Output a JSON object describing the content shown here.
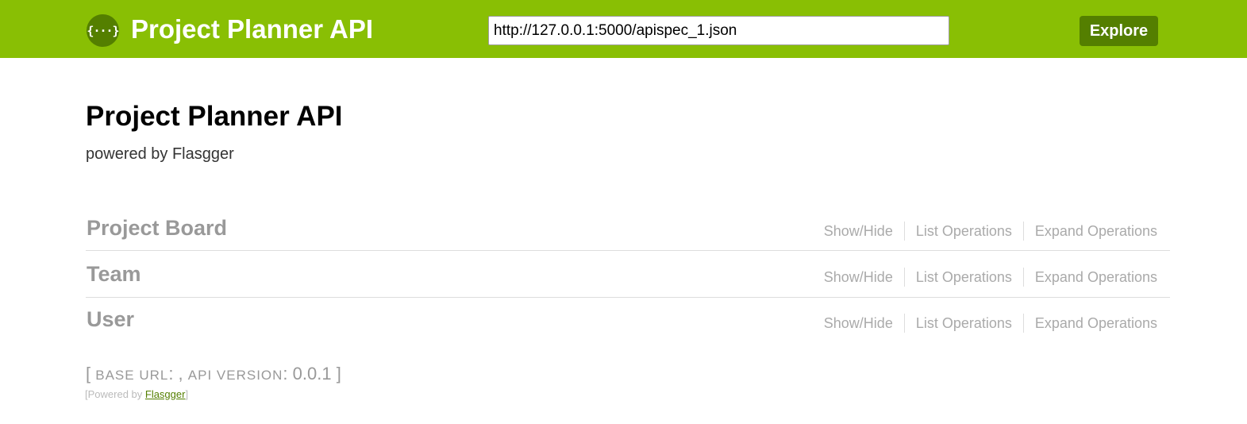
{
  "header": {
    "logo_glyph": "{···}",
    "title": "Project Planner API",
    "spec_url": "http://127.0.0.1:5000/apispec_1.json",
    "explore_label": "Explore",
    "bg_color": "#89bf04",
    "accent_color": "#547f00"
  },
  "info": {
    "title": "Project Planner API",
    "description": "powered by Flasgger"
  },
  "resources": [
    {
      "name": "Project Board",
      "show_hide": "Show/Hide",
      "list_ops": "List Operations",
      "expand_ops": "Expand Operations"
    },
    {
      "name": "Team",
      "show_hide": "Show/Hide",
      "list_ops": "List Operations",
      "expand_ops": "Expand Operations"
    },
    {
      "name": "User",
      "show_hide": "Show/Hide",
      "list_ops": "List Operations",
      "expand_ops": "Expand Operations"
    }
  ],
  "footer": {
    "open_bracket": "[ ",
    "base_url_label": "BASE URL",
    "base_url_value": ": , ",
    "api_version_label": "API VERSION",
    "api_version_value": ": 0.0.1 ]",
    "powered_prefix": "[Powered by ",
    "powered_link": "Flasgger",
    "powered_suffix": "]"
  }
}
